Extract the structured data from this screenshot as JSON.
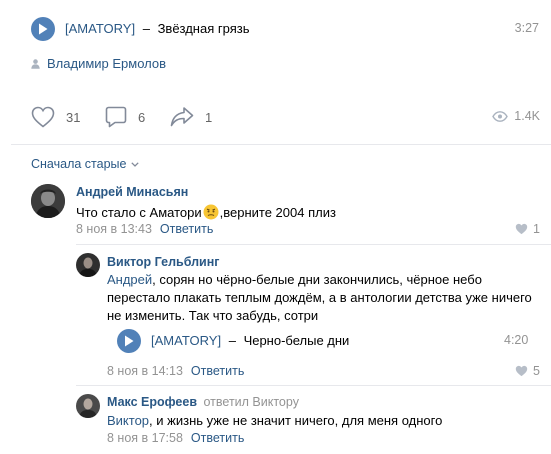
{
  "post": {
    "track": {
      "artist": "[AMATORY]",
      "dash": "–",
      "title": "Звёздная грязь",
      "duration": "3:27"
    },
    "author": "Владимир Ермолов",
    "likes": "31",
    "comments": "6",
    "shares": "1",
    "views": "1.4K"
  },
  "comments_section": {
    "sort_label": "Сначала старые",
    "comments": [
      {
        "name": "Андрей Минасьян",
        "text_before": "Что стало с Аматори ",
        "text_after": ",верните 2004 плиз",
        "date": "8 ноя в 13:43",
        "reply_label": "Ответить",
        "likes": "1"
      },
      {
        "name": "Виктор Гельблинг",
        "addressee": "Андрей",
        "text": ", сорян но чёрно-белые дни закончились, чёрное небо перестало плакать теплым дождём, а в антологии детства уже ничего не изменить. Так что забудь, сотри",
        "track": {
          "artist": "[AMATORY]",
          "dash": "–",
          "title": "Черно-белые дни",
          "duration": "4:20"
        },
        "date": "8 ноя в 14:13",
        "reply_label": "Ответить",
        "likes": "5"
      },
      {
        "name": "Макс Ерофеев",
        "replied_to": "ответил Виктору",
        "addressee": "Виктор",
        "text": ", и жизнь уже не значит ничего, для меня одного",
        "date": "8 ноя в 17:58",
        "reply_label": "Ответить"
      }
    ]
  },
  "colors": {
    "accent": "#5181b8",
    "link": "#2a5885",
    "muted": "#939393"
  }
}
